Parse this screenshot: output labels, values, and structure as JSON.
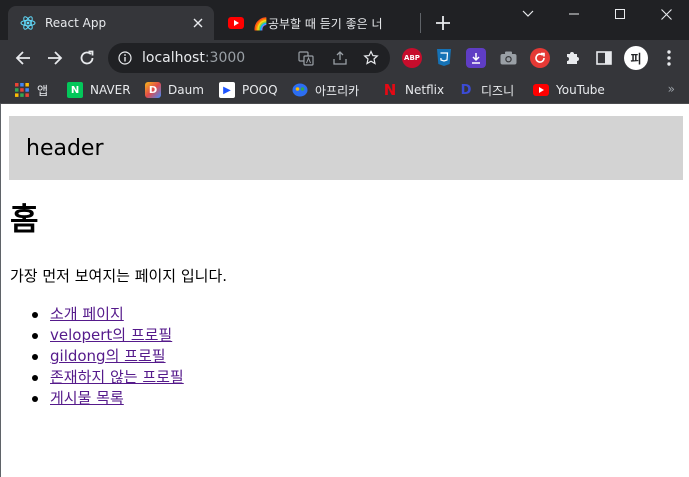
{
  "browser": {
    "tabs": [
      {
        "title": "React App",
        "active": true,
        "icon": "react-icon"
      },
      {
        "title": "🌈공부할 때 듣기 좋은 너",
        "active": false,
        "icon": "youtube-icon"
      }
    ],
    "address": {
      "host": "localhost",
      "port": ":3000"
    },
    "extensions": [
      {
        "name": "abp-extension-icon",
        "text": "ABP",
        "color": "#c70d2c"
      },
      {
        "name": "css-extension-icon",
        "text": "",
        "color": "#1572b6"
      },
      {
        "name": "download-extension-icon",
        "text": "",
        "color": "#5f3dc4"
      },
      {
        "name": "camera-extension-icon",
        "text": "",
        "color": "#9aa0a6"
      },
      {
        "name": "refresh-extension-icon",
        "text": "",
        "color": "#e53935"
      }
    ],
    "profile_initial": "피"
  },
  "bookmarks": [
    {
      "label": "앱",
      "icon": "apps-grid-icon"
    },
    {
      "label": "NAVER",
      "icon": "naver-icon",
      "badge": "N",
      "color": "#03c75a"
    },
    {
      "label": "Daum",
      "icon": "daum-icon",
      "badge": "D",
      "color": "#f6b81a"
    },
    {
      "label": "POOQ",
      "icon": "pooq-icon",
      "badge": "▶",
      "color": "#1e54ff"
    },
    {
      "label": "아프리카",
      "icon": "afreeca-icon",
      "badge": "●",
      "color": "#2c6ef2"
    },
    {
      "label": "Netflix",
      "icon": "netflix-icon",
      "badge": "N",
      "color": "#e50914"
    },
    {
      "label": "디즈니",
      "icon": "disney-icon",
      "badge": "D",
      "color": "#3b4bd6"
    },
    {
      "label": "YouTube",
      "icon": "youtube-icon",
      "badge": "▶",
      "color": "#ff0000"
    }
  ],
  "page": {
    "header": "header",
    "title": "홈",
    "description": "가장 먼저 보여지는 페이지 입니다.",
    "links": [
      "소개 페이지",
      "velopert의 프로필",
      "gildong의 프로필",
      "존재하지 않는 프로필",
      "게시물 목록"
    ]
  }
}
